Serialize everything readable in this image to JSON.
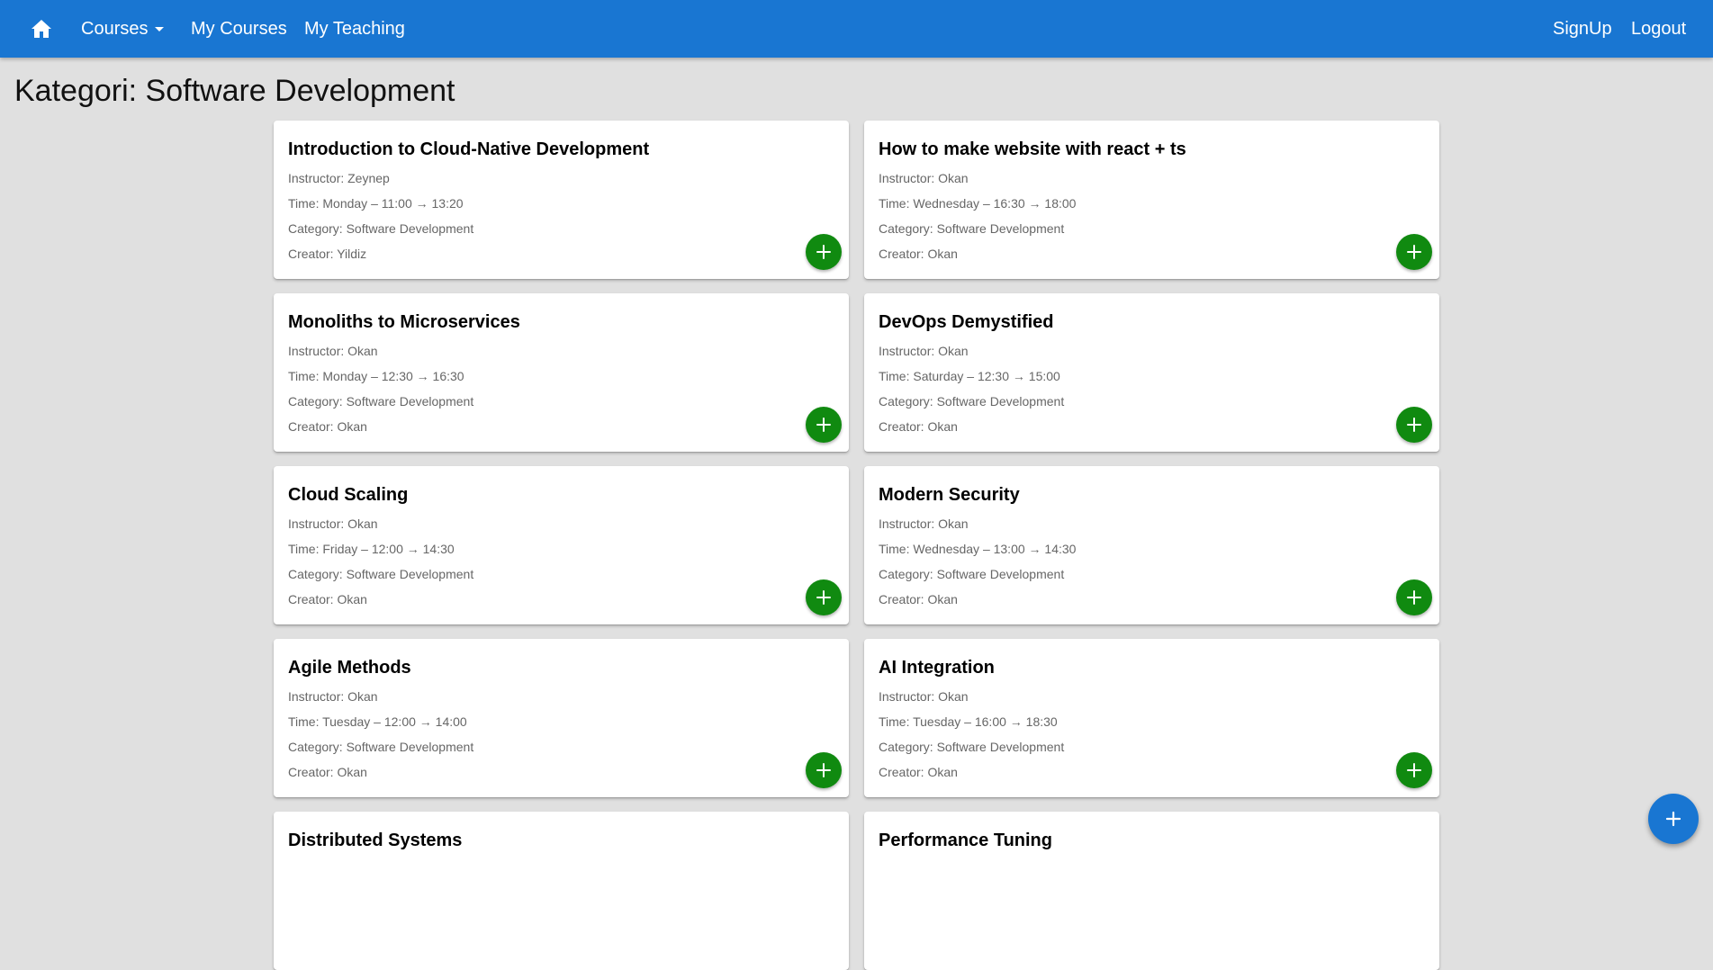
{
  "nav": {
    "home_icon": "home-icon",
    "courses_label": "Courses",
    "my_courses_label": "My Courses",
    "my_teaching_label": "My Teaching",
    "signup_label": "SignUp",
    "logout_label": "Logout"
  },
  "page_title": "Kategori: Software Development",
  "colors": {
    "appbar": "#1976d2",
    "add_button": "#108a10",
    "background": "#e0e0e0"
  },
  "courses": [
    {
      "title": "Introduction to Cloud-Native Development",
      "instructor": "Instructor: Zeynep",
      "time": "Time: Monday – 11:00 → 13:20",
      "category": "Category: Software Development",
      "creator": "Creator: Yildiz"
    },
    {
      "title": "How to make website with react + ts",
      "instructor": "Instructor: Okan",
      "time": "Time: Wednesday – 16:30 → 18:00",
      "category": "Category: Software Development",
      "creator": "Creator: Okan"
    },
    {
      "title": "Monoliths to Microservices",
      "instructor": "Instructor: Okan",
      "time": "Time: Monday – 12:30 → 16:30",
      "category": "Category: Software Development",
      "creator": "Creator: Okan"
    },
    {
      "title": "DevOps Demystified",
      "instructor": "Instructor: Okan",
      "time": "Time: Saturday – 12:30 → 15:00",
      "category": "Category: Software Development",
      "creator": "Creator: Okan"
    },
    {
      "title": "Cloud Scaling",
      "instructor": "Instructor: Okan",
      "time": "Time: Friday – 12:00 → 14:30",
      "category": "Category: Software Development",
      "creator": "Creator: Okan"
    },
    {
      "title": "Modern Security",
      "instructor": "Instructor: Okan",
      "time": "Time: Wednesday – 13:00 → 14:30",
      "category": "Category: Software Development",
      "creator": "Creator: Okan"
    },
    {
      "title": "Agile Methods",
      "instructor": "Instructor: Okan",
      "time": "Time: Tuesday – 12:00 → 14:00",
      "category": "Category: Software Development",
      "creator": "Creator: Okan"
    },
    {
      "title": "AI Integration",
      "instructor": "Instructor: Okan",
      "time": "Time: Tuesday – 16:00 → 18:30",
      "category": "Category: Software Development",
      "creator": "Creator: Okan"
    },
    {
      "title": "Distributed Systems"
    },
    {
      "title": "Performance Tuning"
    }
  ],
  "fab_icon": "add-icon"
}
